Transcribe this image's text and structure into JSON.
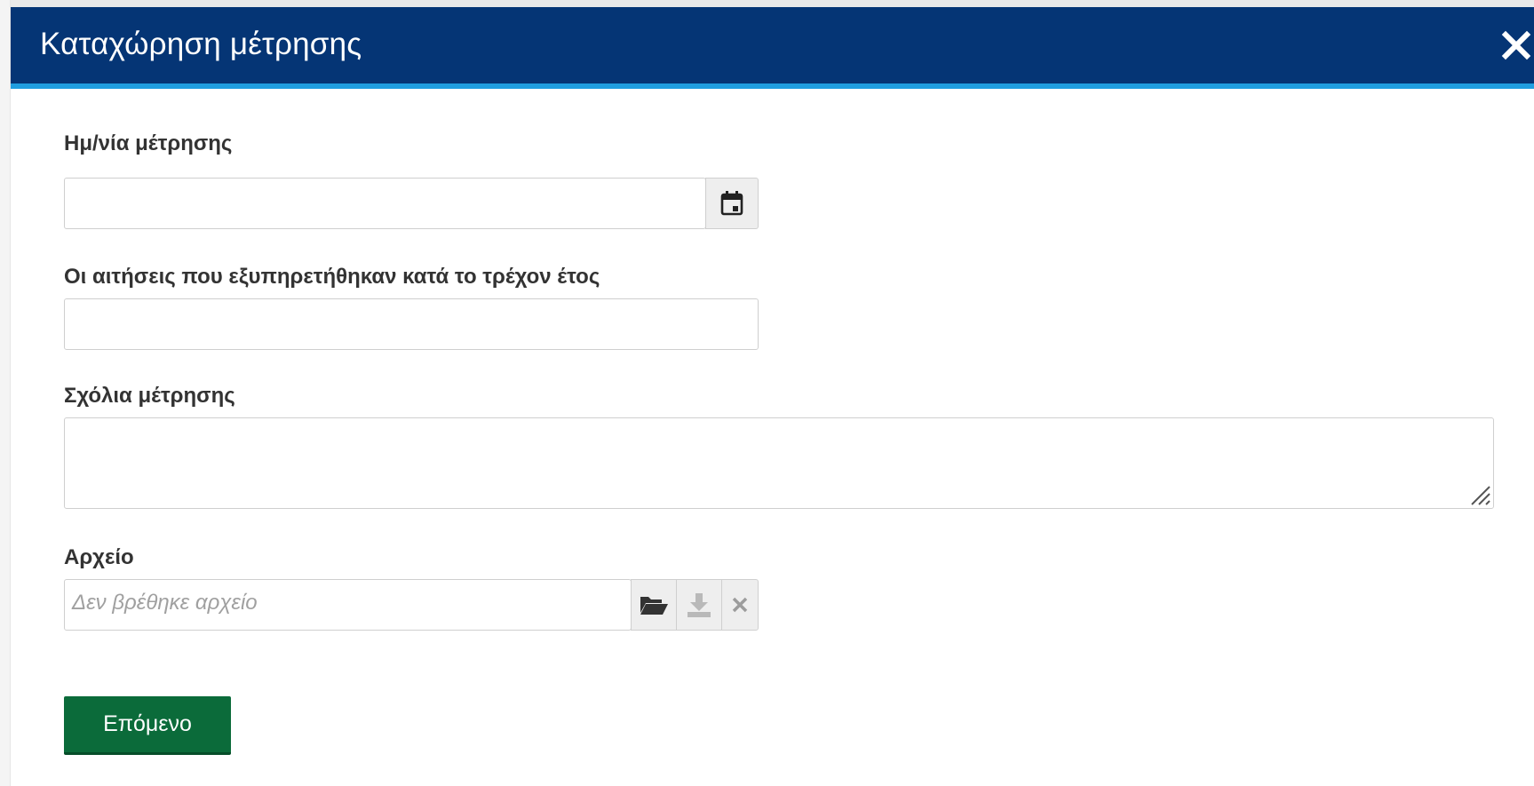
{
  "dialog": {
    "title": "Καταχώρηση μέτρησης",
    "close_icon": "close-icon"
  },
  "form": {
    "date_field": {
      "label": "Ημ/νία μέτρησης",
      "value": "",
      "icon": "calendar-icon"
    },
    "requests_field": {
      "label": "Οι αιτήσεις που εξυπηρετήθηκαν κατά το τρέχον έτος",
      "value": ""
    },
    "comments_field": {
      "label": "Σχόλια μέτρησης",
      "value": ""
    },
    "file_field": {
      "label": "Αρχείο",
      "placeholder": "Δεν βρέθηκε αρχείο",
      "buttons": [
        "folder-open-icon",
        "download-icon",
        "remove-icon"
      ]
    }
  },
  "actions": {
    "next_label": "Επόμενο"
  },
  "colors": {
    "header_bg": "#053575",
    "header_accent": "#1f9ee0",
    "primary_button": "#0b6b3a"
  }
}
